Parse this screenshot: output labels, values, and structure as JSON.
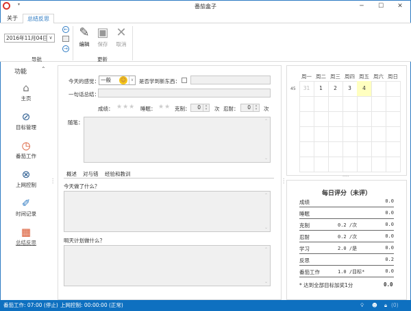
{
  "window": {
    "title": "番茄盒子",
    "min": "─",
    "max": "☐",
    "close": "✕"
  },
  "tabs": [
    {
      "label": "关于"
    },
    {
      "label": "总结反思"
    }
  ],
  "ribbon": {
    "date_value": "2016年11月04日",
    "nav_group": "导航",
    "update_group": "更新",
    "edit": "编辑",
    "save": "保存",
    "cancel": "取消"
  },
  "sidebar": {
    "title": "功能",
    "items": [
      {
        "label": "主页"
      },
      {
        "label": "目标管理"
      },
      {
        "label": "番茄工作"
      },
      {
        "label": "上网控制"
      },
      {
        "label": "时间记录"
      },
      {
        "label": "总结反思"
      }
    ]
  },
  "form": {
    "feeling_label": "今天的感觉：",
    "feeling_value": "一般",
    "learned_label": "是否学到新东西：",
    "summary_label": "一句话总结：",
    "score_label": "成绩：",
    "sleep_label": "睡眠：",
    "restrain_label": "克制：",
    "restrain_value": "0",
    "times1": "次",
    "endure_label": "忍耐：",
    "endure_value": "0",
    "times2": "次",
    "notes_label": "随笔：",
    "subtabs": [
      "概述",
      "对与错",
      "经验和教训"
    ],
    "today_label": "今天做了什么？",
    "tomorrow_label": "明天计划做什么？"
  },
  "calendar": {
    "weekdays": [
      "周一",
      "周二",
      "周三",
      "周四",
      "周五",
      "周六",
      "周日"
    ],
    "week_number": "45",
    "first_row": [
      "31",
      "1",
      "2",
      "3",
      "4",
      "",
      ""
    ],
    "today_index": 4
  },
  "score": {
    "title": "每日评分（未评）",
    "rows": [
      {
        "name": "成绩",
        "rate": "",
        "value": "0.0"
      },
      {
        "name": "睡眠",
        "rate": "",
        "value": "0.0"
      },
      {
        "name": "克制",
        "rate": "0.2 /次",
        "value": "0.0"
      },
      {
        "name": "忍耐",
        "rate": "0.2 /次",
        "value": "0.0"
      },
      {
        "name": "学习",
        "rate": "2.0 /是",
        "value": "0.0"
      },
      {
        "name": "反思",
        "rate": "",
        "value": "0.2"
      },
      {
        "name": "番茄工作",
        "rate": "1.0 /目标*",
        "value": "0.0"
      }
    ],
    "footnote": "* 达到全部目标加奖1分",
    "total": "0.0"
  },
  "status": {
    "pomodoro": "番茄工作: 07:00 (停止)",
    "internet": "上网控制: 00:00:00 (正常)",
    "count": "(0)"
  },
  "colors": {
    "accent": "#2b79c2",
    "status_bg": "#0e70c0",
    "today": "#ffffc0",
    "tomato": "#d9532b"
  }
}
